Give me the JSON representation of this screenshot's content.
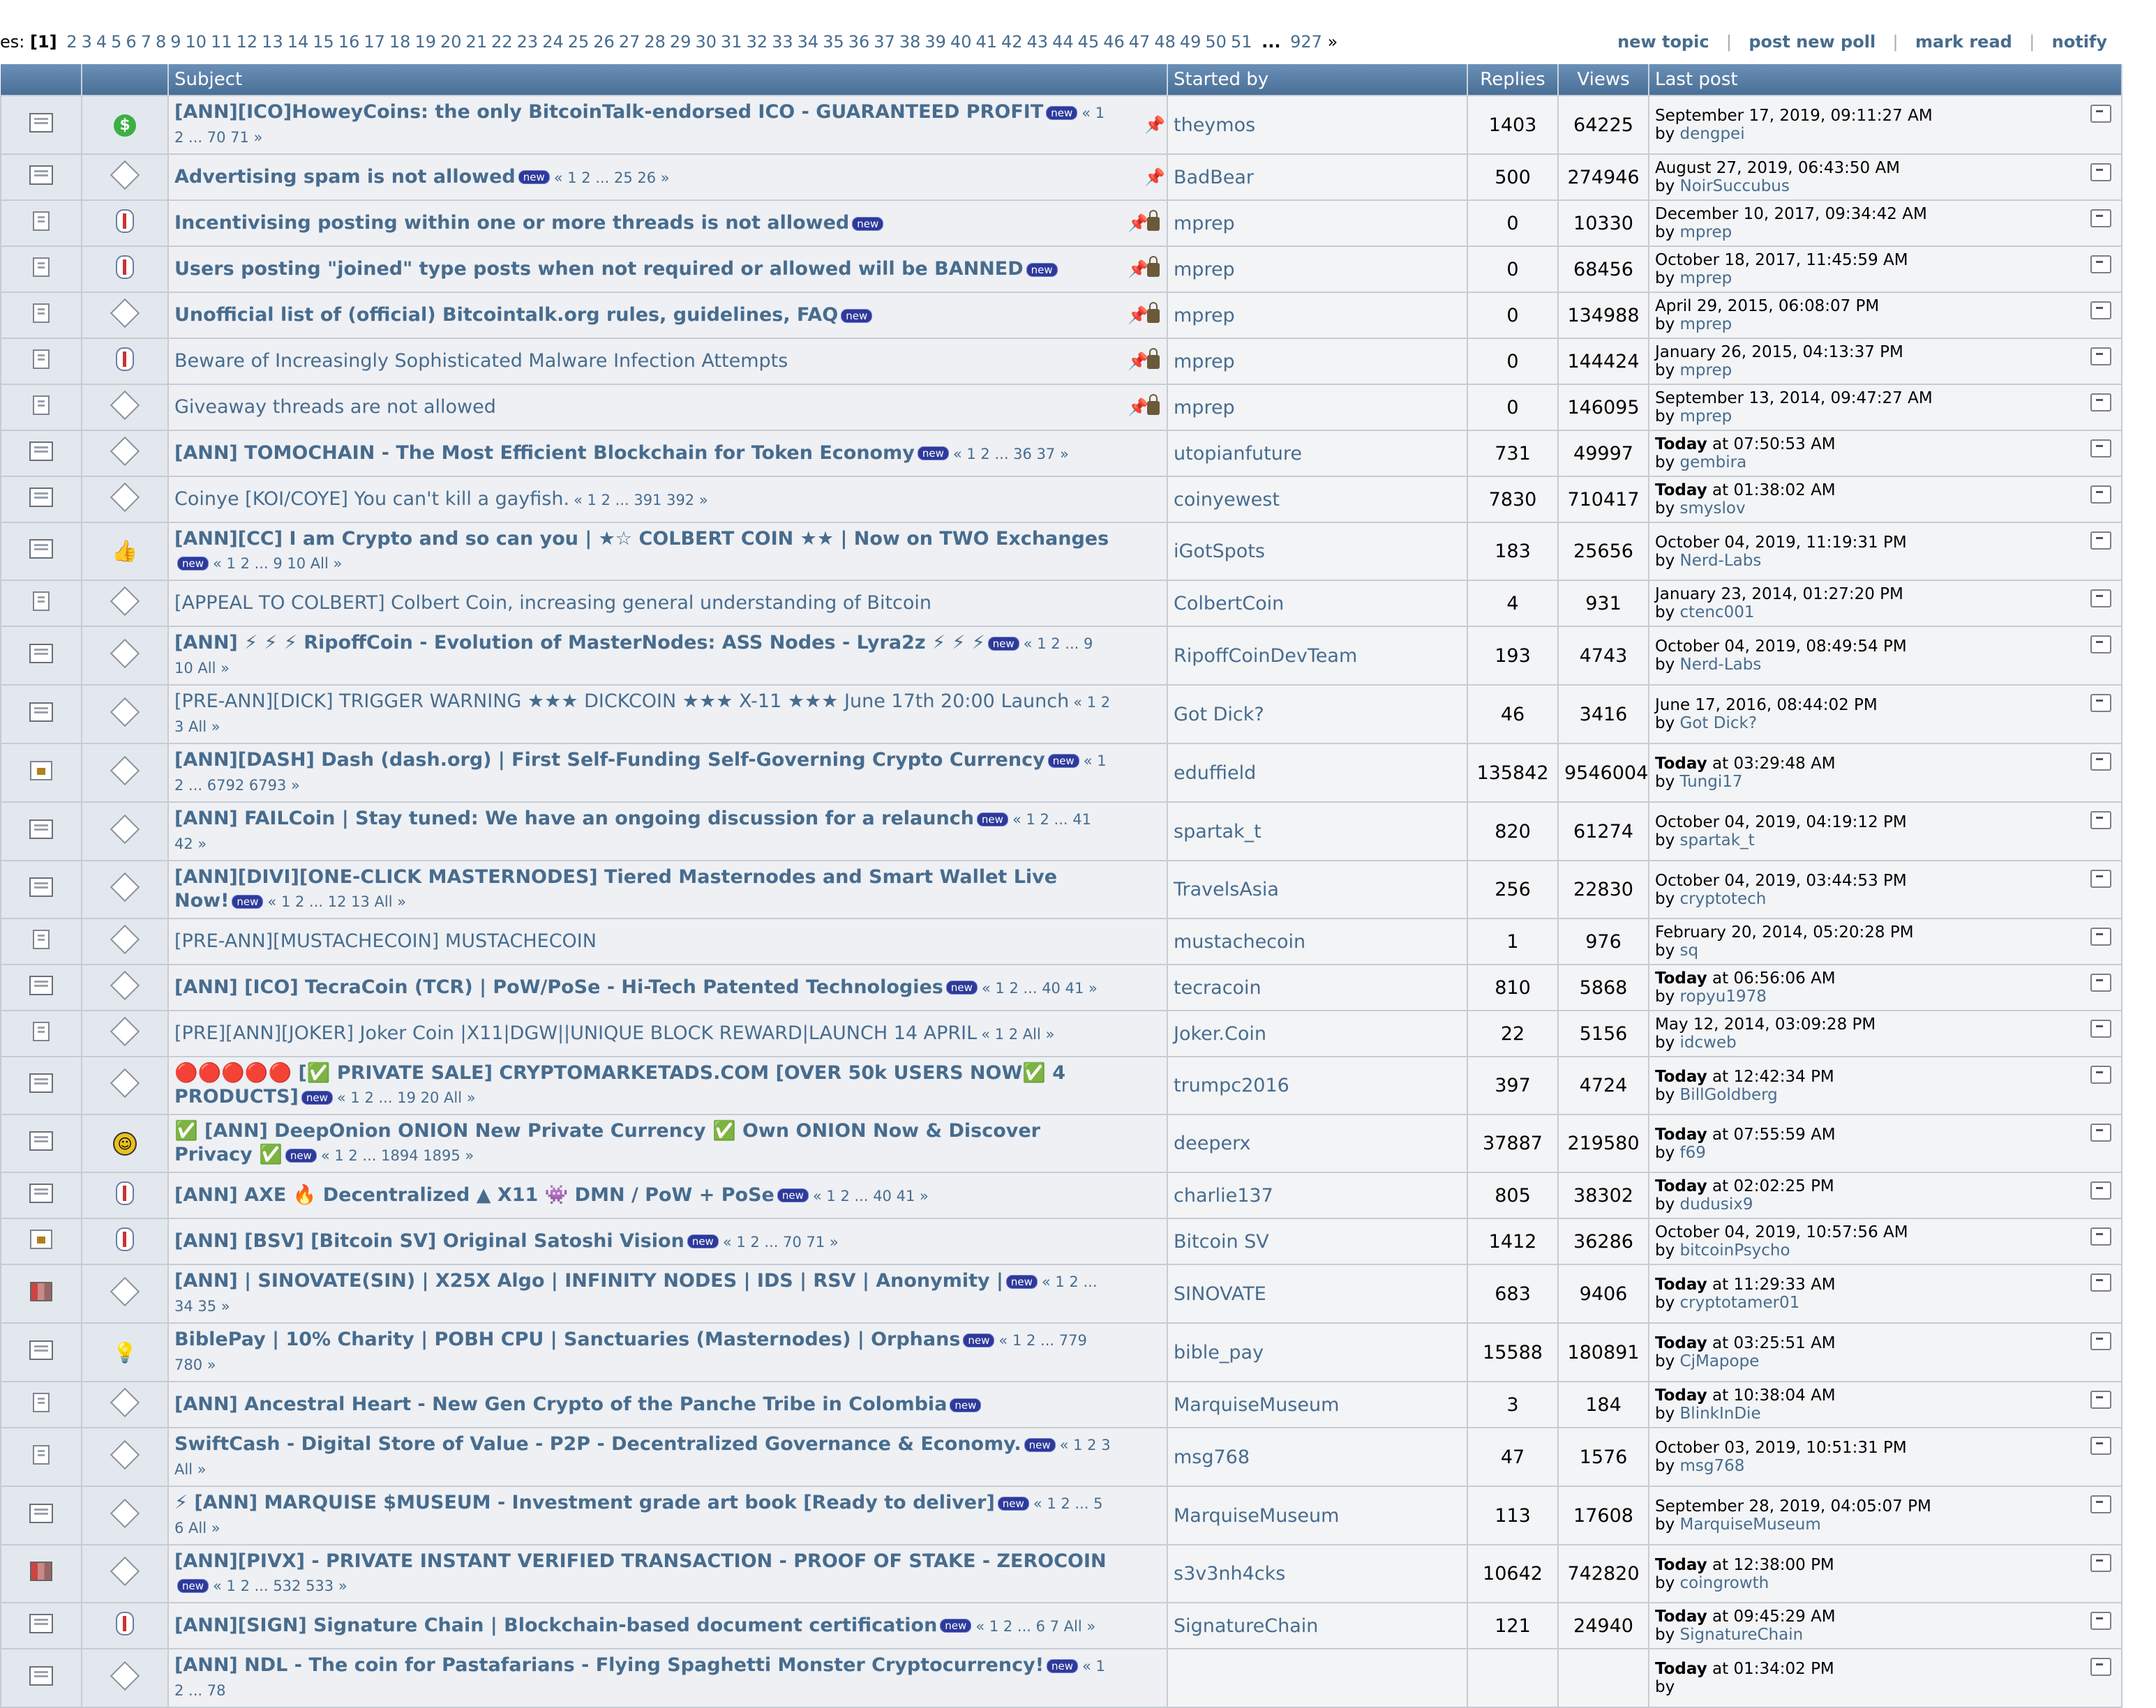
{
  "pagination": {
    "label": "es:",
    "current": "[1]",
    "pages": [
      "2",
      "3",
      "4",
      "5",
      "6",
      "7",
      "8",
      "9",
      "10",
      "11",
      "12",
      "13",
      "14",
      "15",
      "16",
      "17",
      "18",
      "19",
      "20",
      "21",
      "22",
      "23",
      "24",
      "25",
      "26",
      "27",
      "28",
      "29",
      "30",
      "31",
      "32",
      "33",
      "34",
      "35",
      "36",
      "37",
      "38",
      "39",
      "40",
      "41",
      "42",
      "43",
      "44",
      "45",
      "46",
      "47",
      "48",
      "49",
      "50",
      "51"
    ],
    "ellipsis": "...",
    "last": "927",
    "suffix": "»"
  },
  "actions": {
    "new_topic": "new topic",
    "post_new_poll": "post new poll",
    "mark_read": "mark read",
    "notify": "notify",
    "separator": "|"
  },
  "columns": {
    "subject": "Subject",
    "started_by": "Started by",
    "replies": "Replies",
    "views": "Views",
    "last_post": "Last post"
  },
  "topics": [
    {
      "icon": "topic-hot-icon",
      "status": "dollar-icon",
      "title": "[ANN][ICO]HoweyCoins: the only BitcoinTalk-endorsed ICO - GUARANTEED PROFIT",
      "bold": true,
      "new": true,
      "pages": "« 1 2 ... 70 71 »",
      "pinned": true,
      "locked": false,
      "starter": "theymos",
      "replies": "1403",
      "views": "64225",
      "last_time": "September 17, 2019, 09:11:27 AM",
      "last_today": false,
      "last_by": "dengpei"
    },
    {
      "icon": "topic-hot-icon",
      "status": "kite-icon",
      "title": "Advertising spam is not allowed",
      "bold": true,
      "new": true,
      "pages": "« 1 2 ... 25 26 »",
      "pinned": true,
      "locked": false,
      "starter": "BadBear",
      "replies": "500",
      "views": "274946",
      "last_time": "August 27, 2019, 06:43:50 AM",
      "last_today": false,
      "last_by": "NoirSuccubus"
    },
    {
      "icon": "topic-small-icon",
      "status": "pill-icon",
      "title": "Incentivising posting within one or more threads is not allowed",
      "bold": true,
      "new": true,
      "pages": "",
      "pinned": true,
      "locked": true,
      "starter": "mprep",
      "replies": "0",
      "views": "10330",
      "last_time": "December 10, 2017, 09:34:42 AM",
      "last_today": false,
      "last_by": "mprep"
    },
    {
      "icon": "topic-small-icon",
      "status": "pill-icon",
      "title": "Users posting \"joined\" type posts when not required or allowed will be BANNED",
      "bold": true,
      "new": true,
      "pages": "",
      "pinned": true,
      "locked": true,
      "starter": "mprep",
      "replies": "0",
      "views": "68456",
      "last_time": "October 18, 2017, 11:45:59 AM",
      "last_today": false,
      "last_by": "mprep"
    },
    {
      "icon": "topic-small-icon",
      "status": "kite-icon",
      "title": "Unofficial list of (official) Bitcointalk.org rules, guidelines, FAQ",
      "bold": true,
      "new": true,
      "pages": "",
      "pinned": true,
      "locked": true,
      "starter": "mprep",
      "replies": "0",
      "views": "134988",
      "last_time": "April 29, 2015, 06:08:07 PM",
      "last_today": false,
      "last_by": "mprep"
    },
    {
      "icon": "topic-small-icon",
      "status": "pill-icon",
      "title": "Beware of Increasingly Sophisticated Malware Infection Attempts",
      "bold": false,
      "new": false,
      "pages": "",
      "pinned": true,
      "locked": true,
      "starter": "mprep",
      "replies": "0",
      "views": "144424",
      "last_time": "January 26, 2015, 04:13:37 PM",
      "last_today": false,
      "last_by": "mprep"
    },
    {
      "icon": "topic-small-icon",
      "status": "kite-icon",
      "title": "Giveaway threads are not allowed",
      "bold": false,
      "new": false,
      "pages": "",
      "pinned": true,
      "locked": true,
      "starter": "mprep",
      "replies": "0",
      "views": "146095",
      "last_time": "September 13, 2014, 09:47:27 AM",
      "last_today": false,
      "last_by": "mprep"
    },
    {
      "icon": "topic-hot-icon",
      "status": "kite-icon",
      "title": "[ANN] TOMOCHAIN - The Most Efficient Blockchain for Token Economy",
      "bold": true,
      "new": true,
      "pages": "« 1 2 ... 36 37 »",
      "pinned": false,
      "locked": false,
      "starter": "utopianfuture",
      "replies": "731",
      "views": "49997",
      "last_time": "at 07:50:53 AM",
      "last_today": true,
      "last_by": "gembira"
    },
    {
      "icon": "topic-hot-icon",
      "status": "kite-icon",
      "title": "Coinye [KOI/COYE] You can't kill a gayfish.",
      "bold": false,
      "new": false,
      "pages": "« 1 2 ... 391 392 »",
      "pinned": false,
      "locked": false,
      "starter": "coinyewest",
      "replies": "7830",
      "views": "710417",
      "last_time": "at 01:38:02 AM",
      "last_today": true,
      "last_by": "smyslov"
    },
    {
      "icon": "topic-hot-icon",
      "status": "thumb-icon",
      "title": "[ANN][CC] I am Crypto and so can you | ★☆ COLBERT COIN ★★ | Now on TWO Exchanges",
      "bold": true,
      "new": true,
      "pages": "« 1 2 ... 9 10  All »",
      "pinned": false,
      "locked": false,
      "starter": "iGotSpots",
      "replies": "183",
      "views": "25656",
      "last_time": "October 04, 2019, 11:19:31 PM",
      "last_today": false,
      "last_by": "Nerd-Labs"
    },
    {
      "icon": "topic-small-icon",
      "status": "kite-icon",
      "title": "[APPEAL TO COLBERT] Colbert Coin, increasing general understanding of Bitcoin",
      "bold": false,
      "new": false,
      "pages": "",
      "pinned": false,
      "locked": false,
      "starter": "ColbertCoin",
      "replies": "4",
      "views": "931",
      "last_time": "January 23, 2014, 01:27:20 PM",
      "last_today": false,
      "last_by": "ctenc001"
    },
    {
      "icon": "topic-hot-icon",
      "status": "kite-icon",
      "title": "[ANN] ⚡ ⚡ ⚡  RipoffCoin - Evolution of MasterNodes: ASS Nodes - Lyra2z ⚡ ⚡ ⚡",
      "bold": true,
      "new": true,
      "pages": "« 1 2 ... 9 10  All »",
      "pinned": false,
      "locked": false,
      "starter": "RipoffCoinDevTeam",
      "replies": "193",
      "views": "4743",
      "last_time": "October 04, 2019, 08:49:54 PM",
      "last_today": false,
      "last_by": "Nerd-Labs"
    },
    {
      "icon": "topic-hot-icon",
      "status": "kite-icon",
      "title": "[PRE-ANN][DICK] TRIGGER WARNING ★★★ DICKCOIN ★★★ X-11 ★★★ June 17th 20:00 Launch",
      "bold": false,
      "new": false,
      "pages": "« 1 2 3  All »",
      "pinned": false,
      "locked": false,
      "starter": "Got Dick?",
      "replies": "46",
      "views": "3416",
      "last_time": "June 17, 2016, 08:44:02 PM",
      "last_today": false,
      "last_by": "Got Dick?"
    },
    {
      "icon": "topic-lock-icon",
      "status": "kite-icon",
      "title": "[ANN][DASH] Dash (dash.org) | First Self-Funding Self-Governing Crypto Currency",
      "bold": true,
      "new": true,
      "pages": "« 1 2 ... 6792 6793 »",
      "pinned": false,
      "locked": false,
      "starter": "eduffield",
      "replies": "135842",
      "views": "9546004",
      "last_time": "at 03:29:48 AM",
      "last_today": true,
      "last_by": "Tungi17"
    },
    {
      "icon": "topic-hot-icon",
      "status": "kite-icon",
      "title": "[ANN] FAILCoin | Stay tuned: We have an ongoing discussion for a relaunch",
      "bold": true,
      "new": true,
      "pages": "« 1 2 ... 41 42 »",
      "pinned": false,
      "locked": false,
      "starter": "spartak_t",
      "replies": "820",
      "views": "61274",
      "last_time": "October 04, 2019, 04:19:12 PM",
      "last_today": false,
      "last_by": "spartak_t"
    },
    {
      "icon": "topic-hot-icon",
      "status": "kite-icon",
      "title": "[ANN][DIVI][ONE-CLICK MASTERNODES] Tiered Masternodes and Smart Wallet Live Now!",
      "bold": true,
      "new": true,
      "pages": "« 1 2 ... 12 13  All »",
      "pinned": false,
      "locked": false,
      "starter": "TravelsAsia",
      "replies": "256",
      "views": "22830",
      "last_time": "October 04, 2019, 03:44:53 PM",
      "last_today": false,
      "last_by": "cryptotech"
    },
    {
      "icon": "topic-small-icon",
      "status": "kite-icon",
      "title": "[PRE-ANN][MUSTACHECOIN] MUSTACHECOIN",
      "bold": false,
      "new": false,
      "pages": "",
      "pinned": false,
      "locked": false,
      "starter": "mustachecoin",
      "replies": "1",
      "views": "976",
      "last_time": "February 20, 2014, 05:20:28 PM",
      "last_today": false,
      "last_by": "sq"
    },
    {
      "icon": "topic-hot-icon",
      "status": "kite-icon",
      "title": "[ANN] [ICO] TecraCoin (TCR) | PoW/PoSe - Hi-Tech Patented Technologies",
      "bold": true,
      "new": true,
      "pages": "« 1 2 ... 40 41 »",
      "pinned": false,
      "locked": false,
      "starter": "tecracoin",
      "replies": "810",
      "views": "5868",
      "last_time": "at 06:56:06 AM",
      "last_today": true,
      "last_by": "ropyu1978"
    },
    {
      "icon": "topic-small-icon",
      "status": "kite-icon",
      "title": "[PRE][ANN][JOKER] Joker Coin |X11|DGW||UNIQUE BLOCK REWARD|LAUNCH 14 APRIL",
      "bold": false,
      "new": false,
      "pages": "« 1 2  All »",
      "pinned": false,
      "locked": false,
      "starter": "Joker.Coin",
      "replies": "22",
      "views": "5156",
      "last_time": "May 12, 2014, 03:09:28 PM",
      "last_today": false,
      "last_by": "idcweb"
    },
    {
      "icon": "topic-hot-icon",
      "status": "kite-icon",
      "title": "🔴🔴🔴🔴🔴  [✅ PRIVATE SALE]  CRYPTOMARKETADS.COM  [OVER 50k USERS NOW✅ 4 PRODUCTS]",
      "bold": true,
      "new": true,
      "pages": "« 1 2 ... 19 20  All »",
      "pinned": false,
      "locked": false,
      "starter": "trumpc2016",
      "replies": "397",
      "views": "4724",
      "last_time": "at 12:42:34 PM",
      "last_today": true,
      "last_by": "BillGoldberg"
    },
    {
      "icon": "topic-hot-icon",
      "status": "smile-icon",
      "title": "✅ [ANN] DeepOnion ONION New Private Currency ✅  Own ONION Now & Discover Privacy ✅",
      "bold": true,
      "new": true,
      "pages": "« 1 2 ... 1894 1895 »",
      "pinned": false,
      "locked": false,
      "starter": "deeperx",
      "replies": "37887",
      "views": "219580",
      "last_time": "at 07:55:59 AM",
      "last_today": true,
      "last_by": "f69"
    },
    {
      "icon": "topic-hot-icon",
      "status": "pill-icon",
      "title": "[ANN] AXE 🔥  Decentralized ▲ X11 👾  DMN / PoW + PoSe",
      "bold": true,
      "new": true,
      "pages": "« 1 2 ... 40 41 »",
      "pinned": false,
      "locked": false,
      "starter": "charlie137",
      "replies": "805",
      "views": "38302",
      "last_time": "at 02:02:25 PM",
      "last_today": true,
      "last_by": "dudusix9"
    },
    {
      "icon": "topic-lock-icon",
      "status": "pill-icon",
      "title": "[ANN] [BSV] [Bitcoin SV] Original Satoshi Vision",
      "bold": true,
      "new": true,
      "pages": "« 1 2 ... 70 71 »",
      "pinned": false,
      "locked": false,
      "starter": "Bitcoin SV",
      "replies": "1412",
      "views": "36286",
      "last_time": "October 04, 2019, 10:57:56 AM",
      "last_today": false,
      "last_by": "bitcoinPsycho"
    },
    {
      "icon": "topic-chart-icon",
      "status": "kite-icon",
      "title": "[ANN] | SINOVATE(SIN) | X25X Algo | INFINITY NODES | IDS | RSV | Anonymity |",
      "bold": true,
      "new": true,
      "pages": "« 1 2 ... 34 35 »",
      "pinned": false,
      "locked": false,
      "starter": "SINOVATE",
      "replies": "683",
      "views": "9406",
      "last_time": "at 11:29:33 AM",
      "last_today": true,
      "last_by": "cryptotamer01"
    },
    {
      "icon": "topic-hot-icon",
      "status": "bulb-icon",
      "title": "BiblePay | 10% Charity | POBH CPU | Sanctuaries (Masternodes) | Orphans",
      "bold": true,
      "new": true,
      "pages": "« 1 2 ... 779 780 »",
      "pinned": false,
      "locked": false,
      "starter": "bible_pay",
      "replies": "15588",
      "views": "180891",
      "last_time": "at 03:25:51 AM",
      "last_today": true,
      "last_by": "CjMapope"
    },
    {
      "icon": "topic-small-icon",
      "status": "kite-icon",
      "title": "[ANN] Ancestral Heart - New Gen Crypto of the Panche Tribe in Colombia",
      "bold": true,
      "new": true,
      "pages": "",
      "pinned": false,
      "locked": false,
      "starter": "MarquiseMuseum",
      "replies": "3",
      "views": "184",
      "last_time": "at 10:38:04 AM",
      "last_today": true,
      "last_by": "BlinkInDie"
    },
    {
      "icon": "topic-small-icon",
      "status": "kite-icon",
      "title": "SwiftCash - Digital Store of Value - P2P - Decentralized Governance & Economy.",
      "bold": true,
      "new": true,
      "pages": "« 1 2 3  All »",
      "pinned": false,
      "locked": false,
      "starter": "msg768",
      "replies": "47",
      "views": "1576",
      "last_time": "October 03, 2019, 10:51:31 PM",
      "last_today": false,
      "last_by": "msg768"
    },
    {
      "icon": "topic-hot-icon",
      "status": "kite-icon",
      "title": "⚡ [ANN] MARQUISE $MUSEUM - Investment grade art book [Ready to deliver]",
      "bold": true,
      "new": true,
      "pages": "« 1 2 ... 5 6  All »",
      "pinned": false,
      "locked": false,
      "starter": "MarquiseMuseum",
      "replies": "113",
      "views": "17608",
      "last_time": "September 28, 2019, 04:05:07 PM",
      "last_today": false,
      "last_by": "MarquiseMuseum"
    },
    {
      "icon": "topic-chart-icon",
      "status": "kite-icon",
      "title": "[ANN][PIVX] - PRIVATE INSTANT VERIFIED TRANSACTION - PROOF OF STAKE - ZEROCOIN",
      "bold": true,
      "new": true,
      "pages": "« 1 2 ... 532 533 »",
      "pinned": false,
      "locked": false,
      "starter": "s3v3nh4cks",
      "replies": "10642",
      "views": "742820",
      "last_time": "at 12:38:00 PM",
      "last_today": true,
      "last_by": "coingrowth"
    },
    {
      "icon": "topic-hot-icon",
      "status": "pill-icon",
      "title": "[ANN][SIGN] Signature Chain | Blockchain-based document certification",
      "bold": true,
      "new": true,
      "pages": "« 1 2 ... 6 7  All »",
      "pinned": false,
      "locked": false,
      "starter": "SignatureChain",
      "replies": "121",
      "views": "24940",
      "last_time": "at 09:45:29 AM",
      "last_today": true,
      "last_by": "SignatureChain"
    },
    {
      "icon": "topic-hot-icon",
      "status": "kite-icon",
      "title": "[ANN] NDL - The coin for Pastafarians - Flying Spaghetti Monster Cryptocurrency!",
      "bold": true,
      "new": true,
      "pages": "« 1 2 ... 78",
      "pinned": false,
      "locked": false,
      "starter": "",
      "replies": "",
      "views": "",
      "last_time": "at 01:34:02 PM",
      "last_today": true,
      "last_by": ""
    }
  ],
  "labels": {
    "today": "Today",
    "by": "by",
    "new_badge": "new"
  }
}
